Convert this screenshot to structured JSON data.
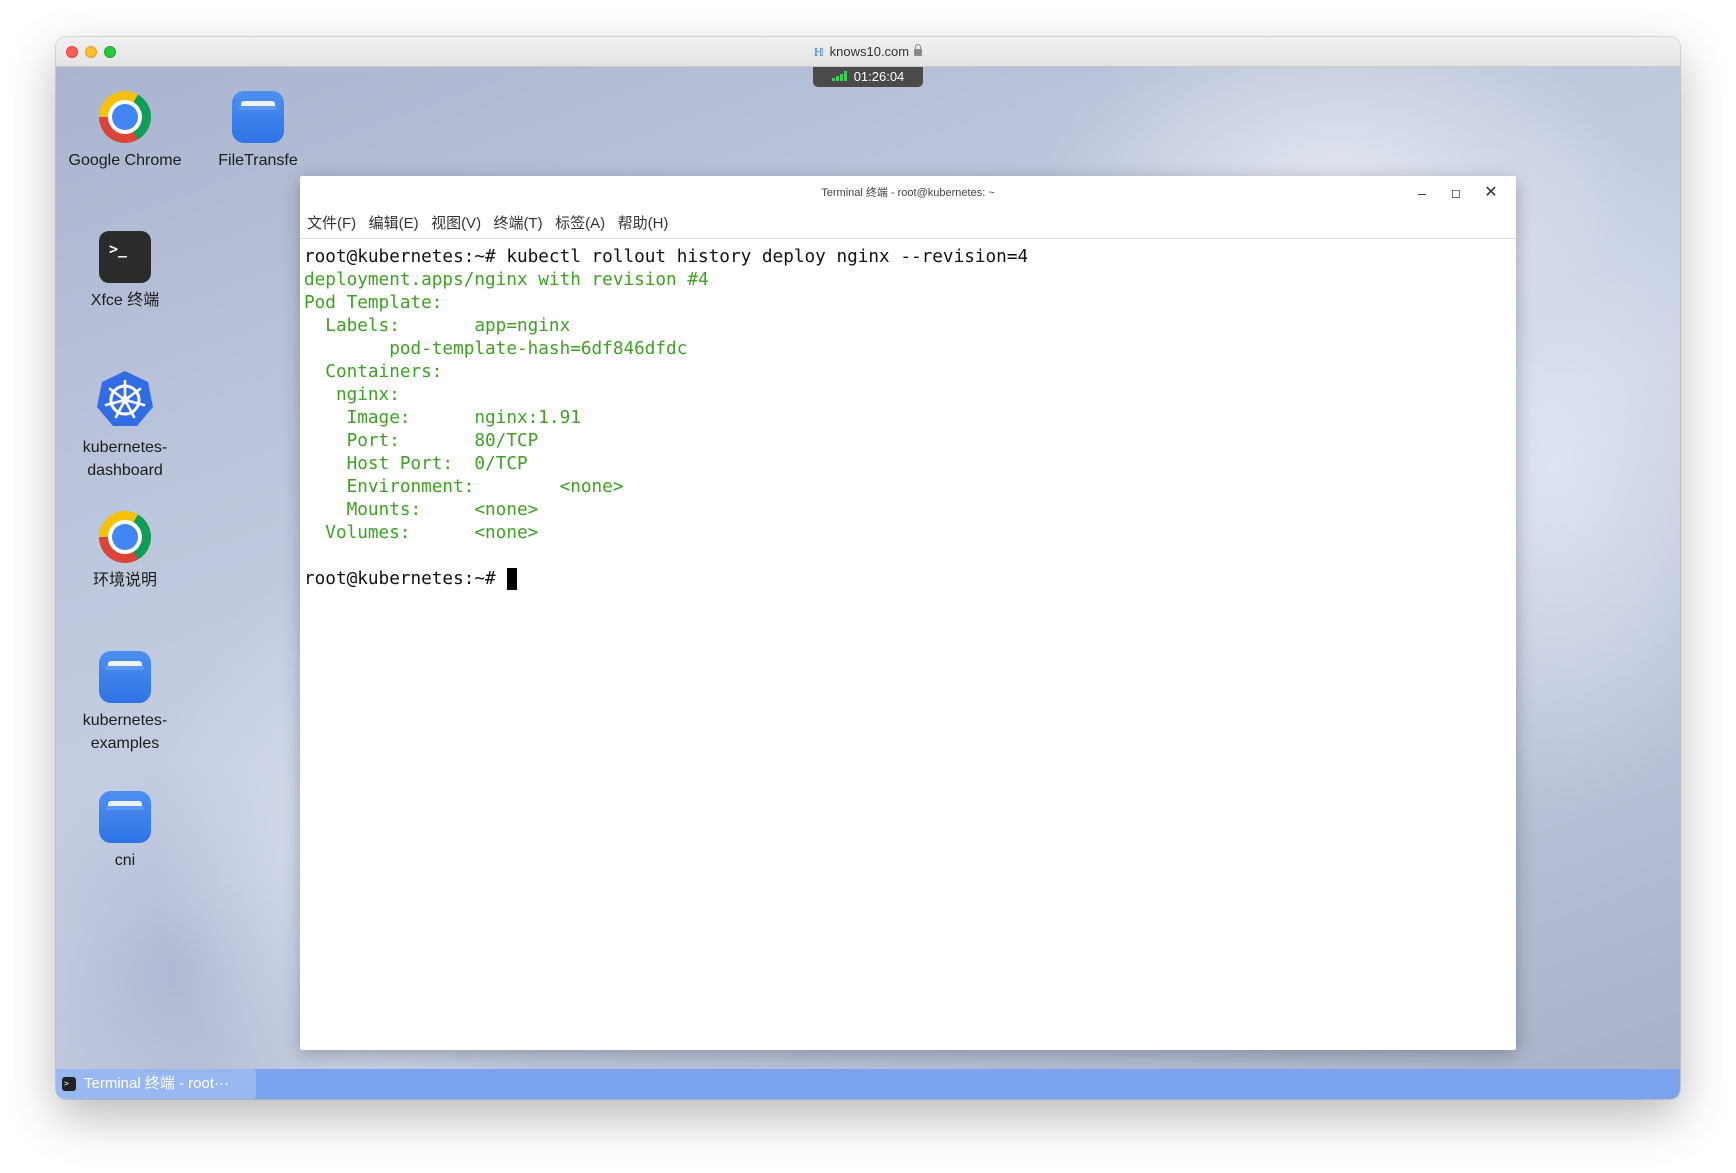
{
  "browser": {
    "address": "knows10.com",
    "timer": "01:26:04"
  },
  "desktop": {
    "icons": [
      {
        "label": "Google Chrome"
      },
      {
        "label": "FileTransfe"
      },
      {
        "label": "Xfce 终端"
      },
      {
        "label_line1": "kubernetes-",
        "label_line2": "dashboard"
      },
      {
        "label": "环境说明"
      },
      {
        "label_line1": "kubernetes-",
        "label_line2": "examples"
      },
      {
        "label": "cni"
      }
    ]
  },
  "terminal": {
    "title": "Terminal 终端 - root@kubernetes: ~",
    "menu": [
      "文件(F)",
      "编辑(E)",
      "视图(V)",
      "终端(T)",
      "标签(A)",
      "帮助(H)"
    ],
    "lines": [
      "root@kubernetes:~# kubectl rollout history deploy nginx --revision=4",
      "deployment.apps/nginx with revision #4",
      "Pod Template:",
      "  Labels:       app=nginx",
      "        pod-template-hash=6df846dfdc",
      "  Containers:",
      "   nginx:",
      "    Image:      nginx:1.91",
      "    Port:       80/TCP",
      "    Host Port:  0/TCP",
      "    Environment:        <none>",
      "    Mounts:     <none>",
      "  Volumes:      <none>",
      "",
      "root@kubernetes:~# "
    ]
  },
  "taskbar": {
    "task_label": "Terminal 终端 - root···"
  },
  "colors": {
    "prompt": "#111111",
    "output": "#3ea123",
    "taskbar": "#7ca4ee"
  }
}
